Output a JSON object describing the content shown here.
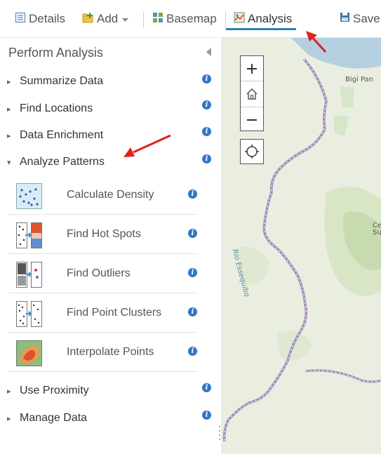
{
  "toolbar": {
    "details": "Details",
    "add": "Add",
    "basemap": "Basemap",
    "analysis": "Analysis",
    "save": "Save"
  },
  "panel": {
    "title": "Perform Analysis",
    "categories": [
      {
        "label": "Summarize Data",
        "expanded": false
      },
      {
        "label": "Find Locations",
        "expanded": false
      },
      {
        "label": "Data Enrichment",
        "expanded": false
      },
      {
        "label": "Analyze Patterns",
        "expanded": true
      },
      {
        "label": "Use Proximity",
        "expanded": false
      },
      {
        "label": "Manage Data",
        "expanded": false
      }
    ],
    "tools": [
      {
        "label": "Calculate Density"
      },
      {
        "label": "Find Hot Spots"
      },
      {
        "label": "Find Outliers"
      },
      {
        "label": "Find Point Clusters"
      },
      {
        "label": "Interpolate Points"
      }
    ],
    "info_glyph": "i"
  },
  "map": {
    "zoom_in": "+",
    "zoom_out": "−",
    "labels": {
      "bigi_pan": "Bigi Pan",
      "rio_essequibo": "Rio Essequibo",
      "ce_su": [
        "Ce",
        "Su"
      ]
    }
  },
  "colors": {
    "accent": "#2b7fc0",
    "info": "#2e78c4",
    "annotation_arrow": "#e02020",
    "map_land": "#e8eee0",
    "map_water": "#b4cfe0",
    "border_line": "#9e88b8"
  },
  "icons": [
    "details-icon",
    "add-icon",
    "basemap-icon",
    "analysis-icon",
    "save-icon"
  ]
}
